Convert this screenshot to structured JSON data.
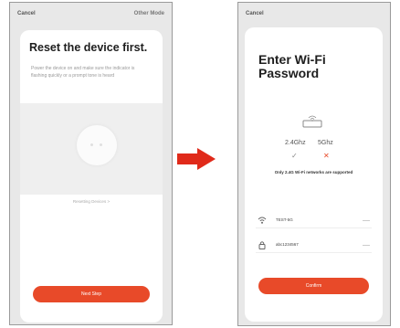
{
  "left_screen": {
    "cancel": "Cancel",
    "other_mode": "Other Mode",
    "title": "Reset the device first.",
    "description": "Power the device on and make sure the indicator is flashing quickly or a prompt tone is heard",
    "link": "Resetting Devices >",
    "next_button": "Next Step"
  },
  "right_screen": {
    "cancel": "Cancel",
    "title_line1": "Enter Wi-Fi",
    "title_line2": "Password",
    "band_24": "2.4Ghz",
    "band_5": "5Ghz",
    "supported_note": "Only 2.4G Wi-Fi networks are supported",
    "ssid_value": "TEST-5G",
    "password_value": "abc1234567",
    "confirm_button": "Confirm"
  },
  "colors": {
    "accent": "#e84a29",
    "background": "#e8e8e8"
  },
  "icons": [
    "arrow-right-icon",
    "router-icon",
    "check-icon",
    "cross-icon",
    "wifi-icon",
    "lock-icon"
  ]
}
